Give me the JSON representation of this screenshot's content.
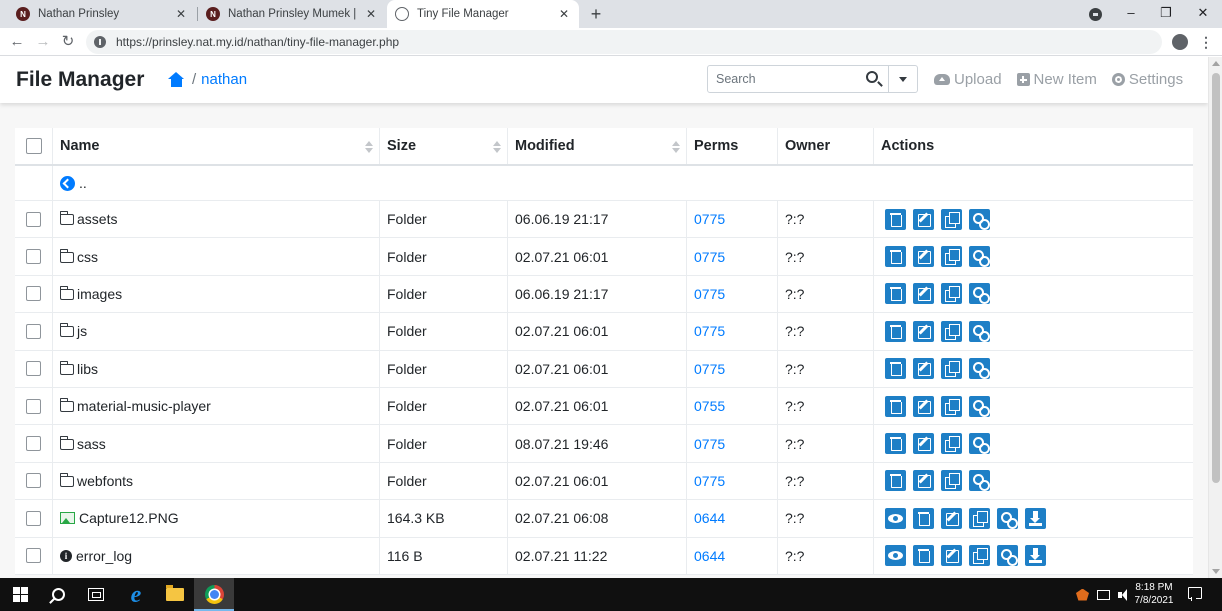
{
  "browser": {
    "tabs": [
      {
        "title": "Nathan Prinsley",
        "icon": "site-favicon"
      },
      {
        "title": "Nathan Prinsley Mumek | Website",
        "icon": "site-favicon"
      },
      {
        "title": "Tiny File Manager",
        "icon": "globe-icon",
        "active": true
      }
    ],
    "url": "https://prinsley.nat.my.id/nathan/tiny-file-manager.php",
    "favicon_letter": "N"
  },
  "app": {
    "brand": "File Manager",
    "breadcrumb": {
      "separator": "/",
      "current": "nathan"
    },
    "search_placeholder": "Search",
    "actions": {
      "upload": "Upload",
      "new_item": "New Item",
      "settings": "Settings"
    }
  },
  "table": {
    "columns": {
      "name": "Name",
      "size": "Size",
      "modified": "Modified",
      "perms": "Perms",
      "owner": "Owner",
      "actions": "Actions"
    },
    "parent_label": "..",
    "rows": [
      {
        "name": "assets",
        "type": "folder",
        "size": "Folder",
        "modified": "06.06.19 21:17",
        "perms": "0775",
        "owner": "?:?"
      },
      {
        "name": "css",
        "type": "folder",
        "size": "Folder",
        "modified": "02.07.21 06:01",
        "perms": "0775",
        "owner": "?:?"
      },
      {
        "name": "images",
        "type": "folder",
        "size": "Folder",
        "modified": "06.06.19 21:17",
        "perms": "0775",
        "owner": "?:?"
      },
      {
        "name": "js",
        "type": "folder",
        "size": "Folder",
        "modified": "02.07.21 06:01",
        "perms": "0775",
        "owner": "?:?"
      },
      {
        "name": "libs",
        "type": "folder",
        "size": "Folder",
        "modified": "02.07.21 06:01",
        "perms": "0775",
        "owner": "?:?"
      },
      {
        "name": "material-music-player",
        "type": "folder",
        "size": "Folder",
        "modified": "02.07.21 06:01",
        "perms": "0755",
        "owner": "?:?"
      },
      {
        "name": "sass",
        "type": "folder",
        "size": "Folder",
        "modified": "08.07.21 19:46",
        "perms": "0775",
        "owner": "?:?"
      },
      {
        "name": "webfonts",
        "type": "folder",
        "size": "Folder",
        "modified": "02.07.21 06:01",
        "perms": "0775",
        "owner": "?:?"
      },
      {
        "name": "Capture12.PNG",
        "type": "image",
        "size": "164.3 KB",
        "modified": "02.07.21 06:08",
        "perms": "0644",
        "owner": "?:?"
      },
      {
        "name": "error_log",
        "type": "file",
        "size": "116 B",
        "modified": "02.07.21 11:22",
        "perms": "0644",
        "owner": "?:?"
      }
    ]
  },
  "taskbar": {
    "time": "8:18 PM",
    "date": "7/8/2021",
    "icons": [
      "windows-start-icon",
      "search-icon",
      "task-view-icon",
      "internet-explorer-icon",
      "file-explorer-icon",
      "chrome-icon"
    ]
  },
  "colors": {
    "accent": "#007bff",
    "action_button": "#1e7fc6",
    "tab_strip": "#dee1e6",
    "taskbar": "#101010"
  }
}
